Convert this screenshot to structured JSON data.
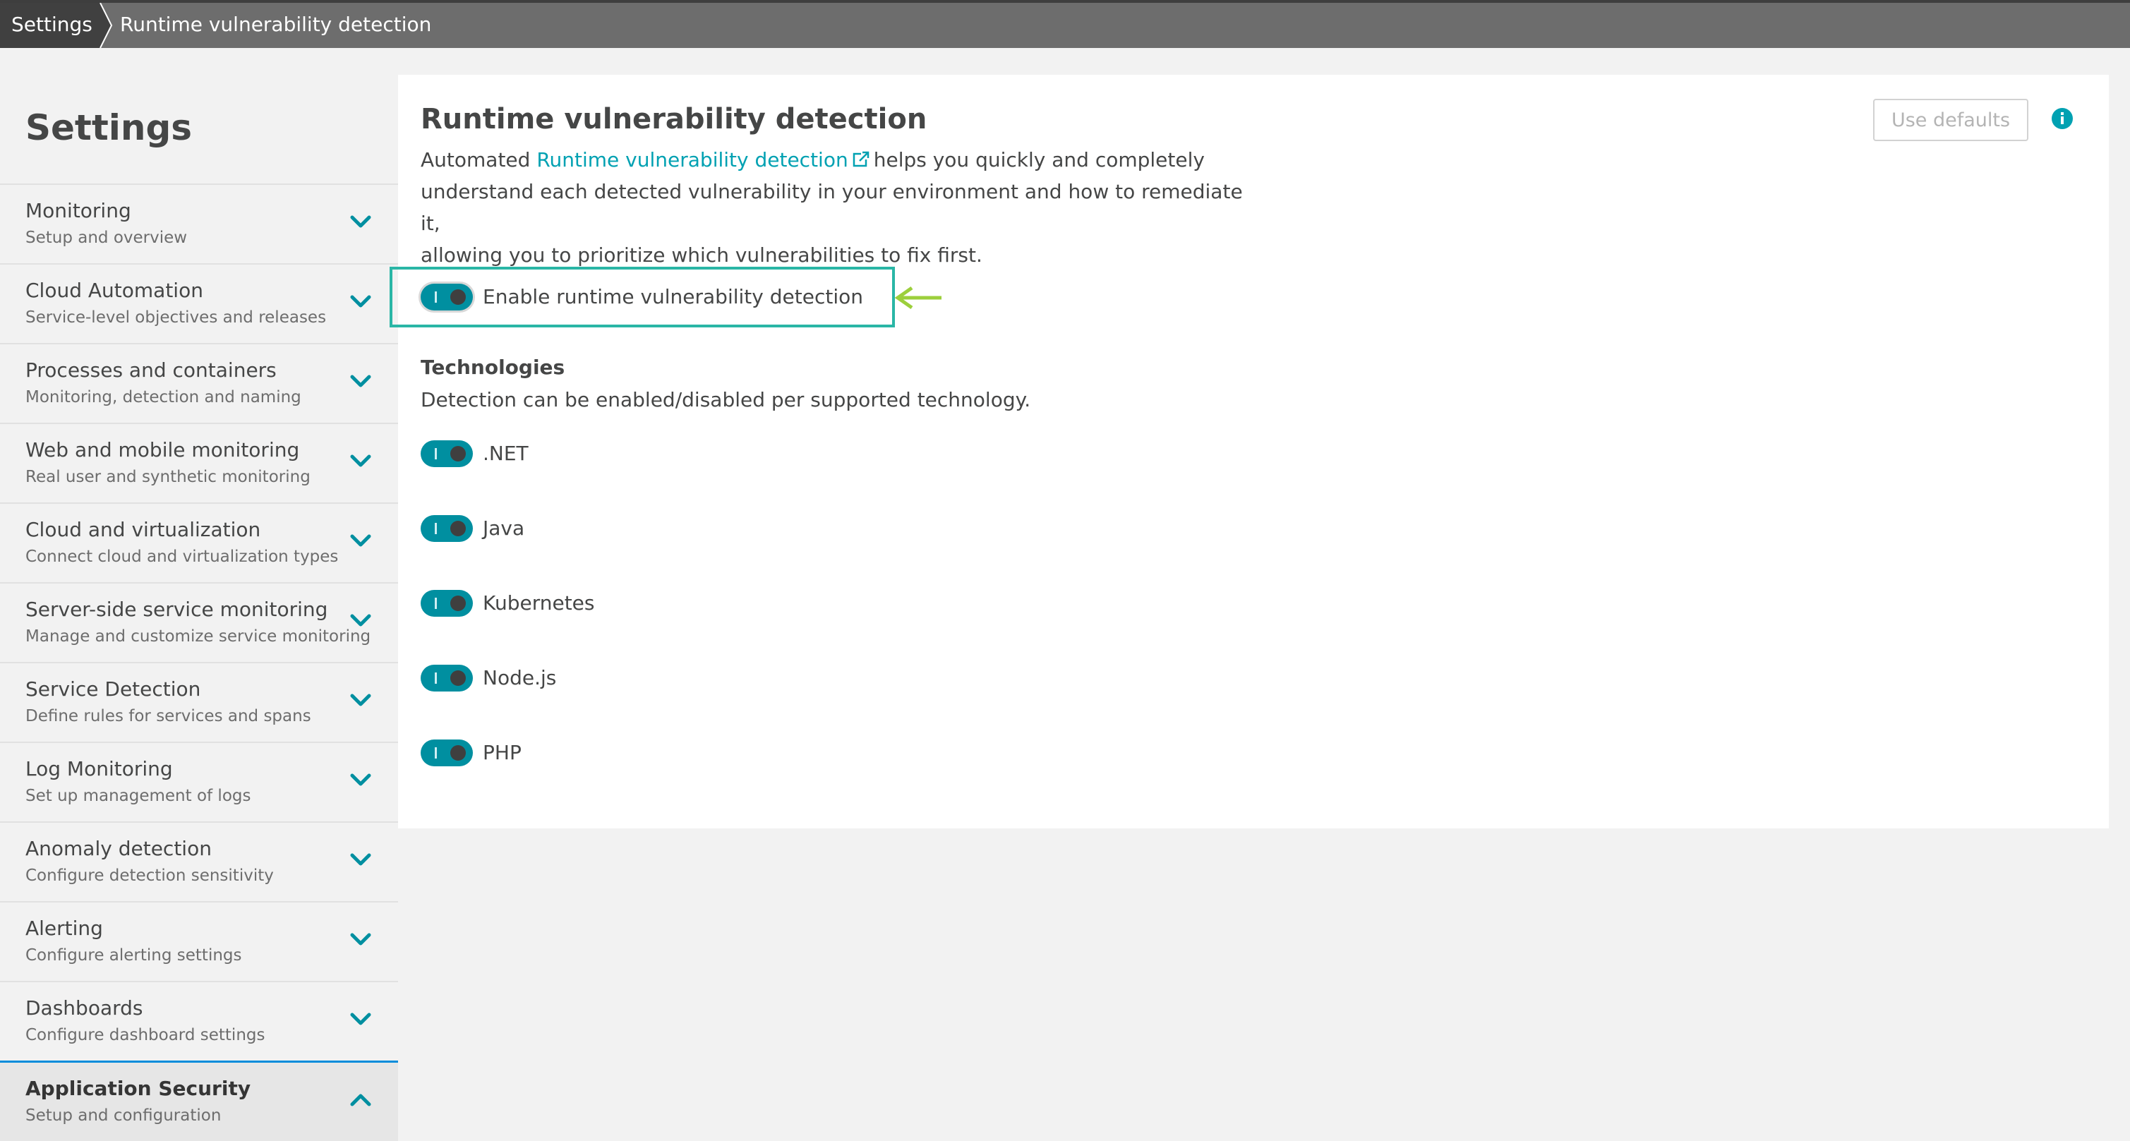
{
  "breadcrumb": {
    "root": "Settings",
    "current": "Runtime vulnerability detection"
  },
  "sidebar": {
    "title": "Settings",
    "items": [
      {
        "label": "Monitoring",
        "description": "Setup and overview",
        "expanded": false
      },
      {
        "label": "Cloud Automation",
        "description": "Service-level objectives and releases",
        "expanded": false
      },
      {
        "label": "Processes and containers",
        "description": "Monitoring, detection and naming",
        "expanded": false
      },
      {
        "label": "Web and mobile monitoring",
        "description": "Real user and synthetic monitoring",
        "expanded": false
      },
      {
        "label": "Cloud and virtualization",
        "description": "Connect cloud and virtualization types",
        "expanded": false
      },
      {
        "label": "Server-side service monitoring",
        "description": "Manage and customize service monitoring",
        "expanded": false
      },
      {
        "label": "Service Detection",
        "description": "Define rules for services and spans",
        "expanded": false
      },
      {
        "label": "Log Monitoring",
        "description": "Set up management of logs",
        "expanded": false
      },
      {
        "label": "Anomaly detection",
        "description": "Configure detection sensitivity",
        "expanded": false
      },
      {
        "label": "Alerting",
        "description": "Configure alerting settings",
        "expanded": false
      },
      {
        "label": "Dashboards",
        "description": "Configure dashboard settings",
        "expanded": false
      },
      {
        "label": "Application Security",
        "description": "Setup and configuration",
        "expanded": true
      }
    ]
  },
  "main": {
    "title": "Runtime vulnerability detection",
    "intro_prefix": "Automated",
    "intro_link": "Runtime vulnerability detection",
    "intro_line1_rest": "helps you quickly and completely",
    "intro_line2": "understand each detected vulnerability in your environment and how to remediate it,",
    "intro_line3": "allowing you to prioritize which vulnerabilities to fix first.",
    "use_defaults_label": "Use defaults",
    "enable_toggle": {
      "label": "Enable runtime vulnerability detection",
      "on": true
    },
    "technologies": {
      "heading": "Technologies",
      "description": "Detection can be enabled/disabled per supported technology.",
      "items": [
        {
          "label": ".NET",
          "on": true
        },
        {
          "label": "Java",
          "on": true
        },
        {
          "label": "Kubernetes",
          "on": true
        },
        {
          "label": "Node.js",
          "on": true
        },
        {
          "label": "PHP",
          "on": true
        }
      ]
    }
  },
  "colors": {
    "accent": "#00a1b2",
    "toggle_on": "#008fa0",
    "highlight_box": "#2ab6a6",
    "annotation_arrow": "#9ccf3c",
    "chevron": "#008fa0",
    "breadcrumb_bar": "#6d6d6d"
  },
  "icons": {
    "nav_collapsed": "chevron-down-icon",
    "nav_expanded": "chevron-up-icon",
    "external_link": "external-link-icon",
    "info": "info-icon",
    "annotation": "arrow-left-icon"
  }
}
